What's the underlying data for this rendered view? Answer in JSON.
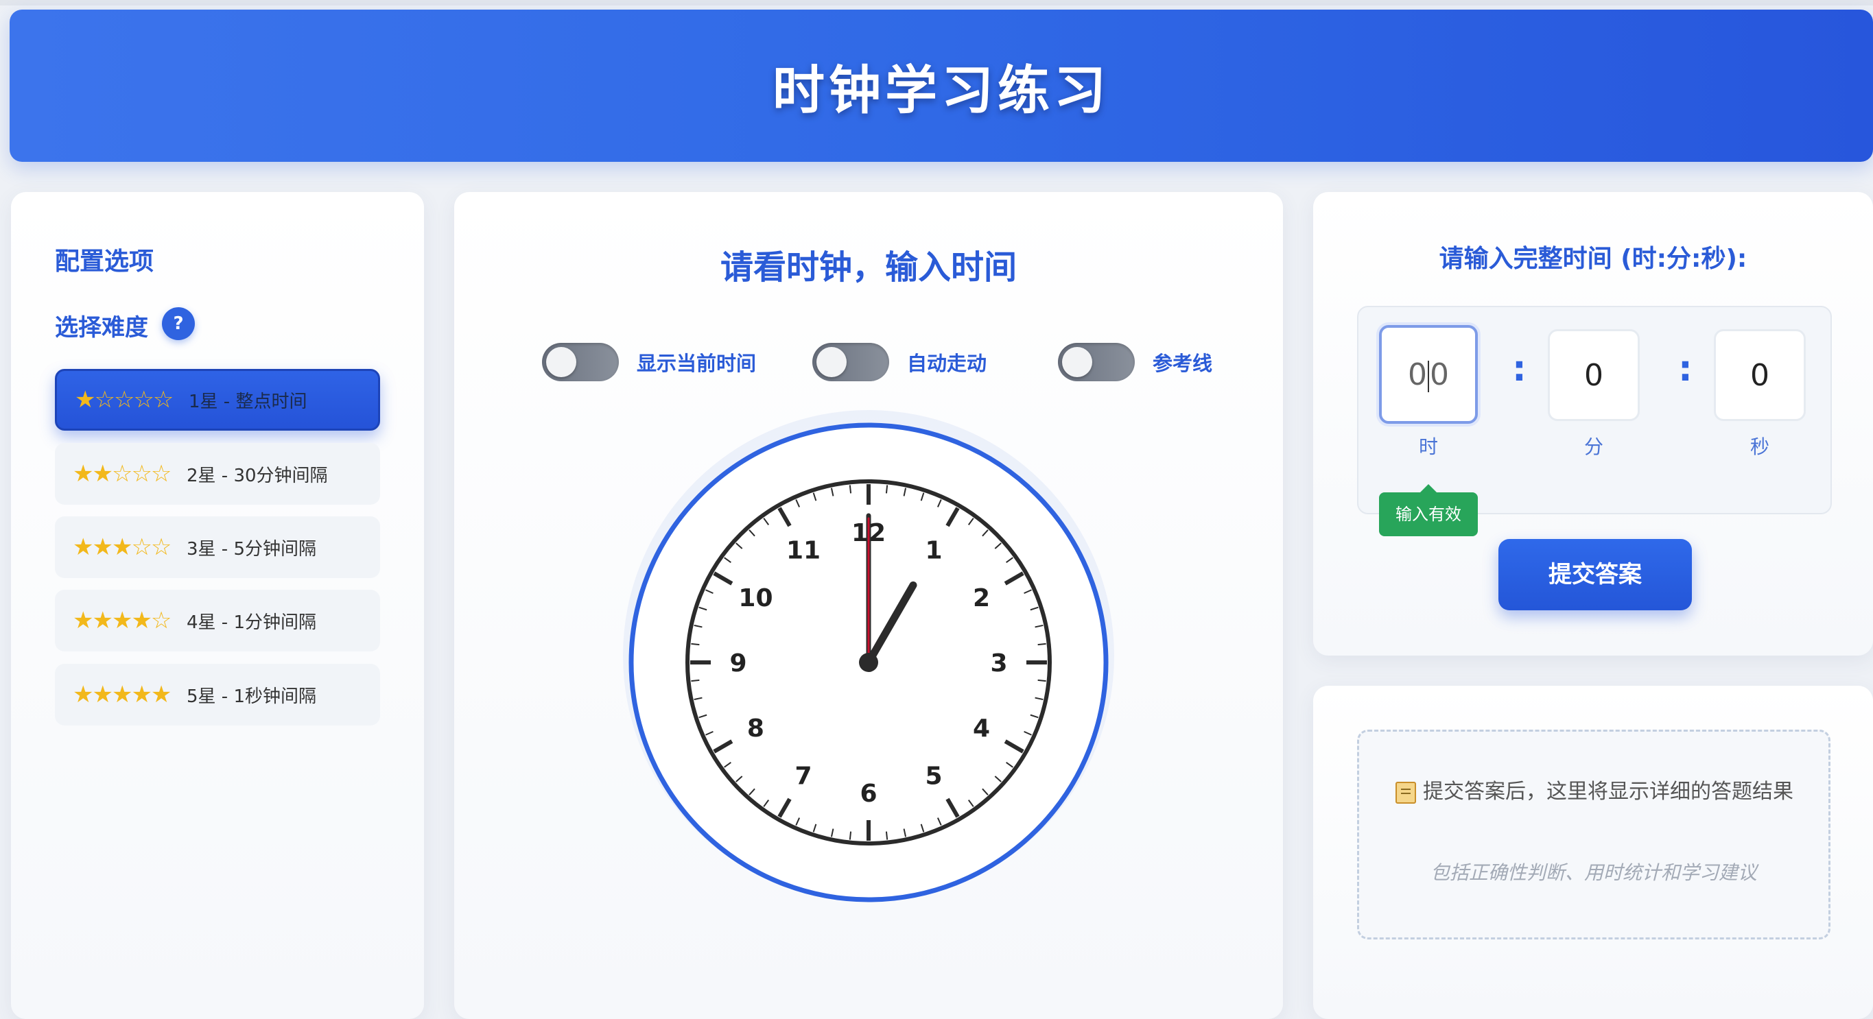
{
  "header": {
    "title": "时钟学习练习"
  },
  "config": {
    "title": "配置选项",
    "difficulty_title": "选择难度",
    "help_label": "?",
    "levels": [
      {
        "stars": "★☆☆☆☆",
        "label": "1星 - 整点时间",
        "active": true
      },
      {
        "stars": "★★☆☆☆",
        "label": "2星 - 30分钟间隔",
        "active": false
      },
      {
        "stars": "★★★☆☆",
        "label": "3星 - 5分钟间隔",
        "active": false
      },
      {
        "stars": "★★★★☆",
        "label": "4星 - 1分钟间隔",
        "active": false
      },
      {
        "stars": "★★★★★",
        "label": "5星 - 1秒钟间隔",
        "active": false
      }
    ]
  },
  "clock_panel": {
    "title": "请看时钟，输入时间",
    "toggles": [
      {
        "label": "显示当前时间",
        "on": false
      },
      {
        "label": "自动走动",
        "on": false
      },
      {
        "label": "参考线",
        "on": false
      }
    ],
    "clock": {
      "hour": 1,
      "minute": 0,
      "second": 0,
      "numbers": [
        "12",
        "1",
        "2",
        "3",
        "4",
        "5",
        "6",
        "7",
        "8",
        "9",
        "10",
        "11"
      ],
      "ring_color": "#2f63e0",
      "second_hand_color": "#c8102e"
    }
  },
  "answer": {
    "title": "请输入完整时间 (时:分:秒):",
    "hour_value": "00",
    "minute_value": "0",
    "second_value": "0",
    "separator": ":",
    "hour_unit": "时",
    "minute_unit": "分",
    "second_unit": "秒",
    "valid_text": "输入有效",
    "submit_label": "提交答案"
  },
  "result": {
    "message": "提交答案后，这里将显示详细的答题结果",
    "hint": "包括正确性判断、用时统计和学习建议"
  }
}
